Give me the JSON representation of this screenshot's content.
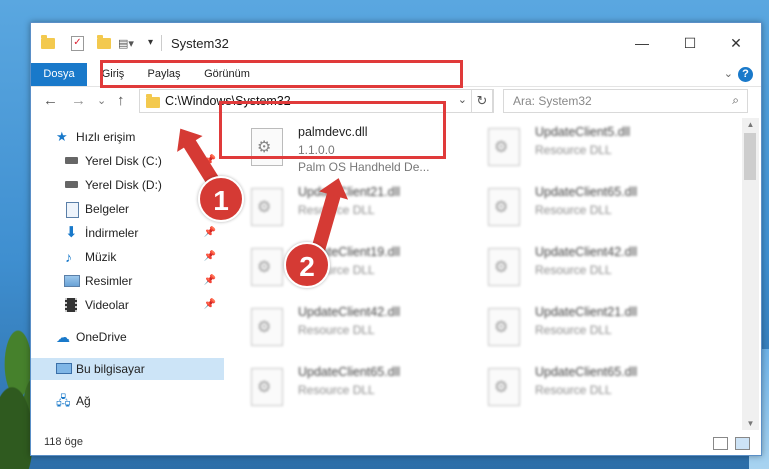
{
  "window": {
    "title": "System32",
    "controls": {
      "minimize": "—",
      "maximize": "☐",
      "close": "✕"
    }
  },
  "ribbon": {
    "tabs": [
      {
        "label": "Dosya",
        "active": true
      },
      {
        "label": "Giriş"
      },
      {
        "label": "Paylaş"
      },
      {
        "label": "Görünüm"
      }
    ],
    "help": "?",
    "collapse": "⌄"
  },
  "navigation": {
    "back": "←",
    "forward": "→",
    "recent": "⌄",
    "up": "↑",
    "address": "C:\\Windows\\System32",
    "search_placeholder": "Ara: System32",
    "refresh": "↻",
    "dropdown": "⌄"
  },
  "nav_pane": {
    "items": [
      {
        "label": "Hızlı erişim",
        "icon": "star-icon",
        "pin": false
      },
      {
        "label": "Yerel Disk (C:)",
        "icon": "drive-icon",
        "pin": true
      },
      {
        "label": "Yerel Disk (D:)",
        "icon": "drive-icon",
        "pin": true
      },
      {
        "label": "Belgeler",
        "icon": "documents-icon",
        "pin": true
      },
      {
        "label": "İndirmeler",
        "icon": "download-icon",
        "pin": true
      },
      {
        "label": "Müzik",
        "icon": "music-icon",
        "pin": true
      },
      {
        "label": "Resimler",
        "icon": "pictures-icon",
        "pin": true
      },
      {
        "label": "Videolar",
        "icon": "videos-icon",
        "pin": true
      },
      {
        "label": "OneDrive",
        "icon": "cloud-icon",
        "pin": false
      },
      {
        "label": "Bu bilgisayar",
        "icon": "computer-icon",
        "pin": false,
        "selected": true
      },
      {
        "label": "Ağ",
        "icon": "network-icon",
        "pin": false
      }
    ]
  },
  "files": [
    {
      "name": "palmdevc.dll",
      "line2": "1.1.0.0",
      "line3": "Palm OS Handheld De...",
      "blurred": false
    },
    {
      "name": "UpdateClient5.dll",
      "line2": "Resource DLL",
      "blurred": true
    },
    {
      "name": "UpdateClient21.dll",
      "line2": "Resource DLL",
      "blurred": true
    },
    {
      "name": "UpdateClient65.dll",
      "line2": "Resource DLL",
      "blurred": true
    },
    {
      "name": "UpdateClient19.dll",
      "line2": "Resource DLL",
      "blurred": true
    },
    {
      "name": "UpdateClient42.dll",
      "line2": "Resource DLL",
      "blurred": true
    },
    {
      "name": "UpdateClient42.dll",
      "line2": "Resource DLL",
      "blurred": true
    },
    {
      "name": "UpdateClient21.dll",
      "line2": "Resource DLL",
      "blurred": true
    },
    {
      "name": "UpdateClient65.dll",
      "line2": "Resource DLL",
      "blurred": true
    },
    {
      "name": "UpdateClient65.dll",
      "line2": "Resource DLL",
      "blurred": true
    }
  ],
  "status": {
    "count": "118 öge"
  },
  "annotations": {
    "step1": "1",
    "step2": "2"
  },
  "colors": {
    "accent": "#1979ca",
    "highlight": "#e03a3a",
    "bubble": "#d53a34",
    "selected": "#cce4f7"
  }
}
